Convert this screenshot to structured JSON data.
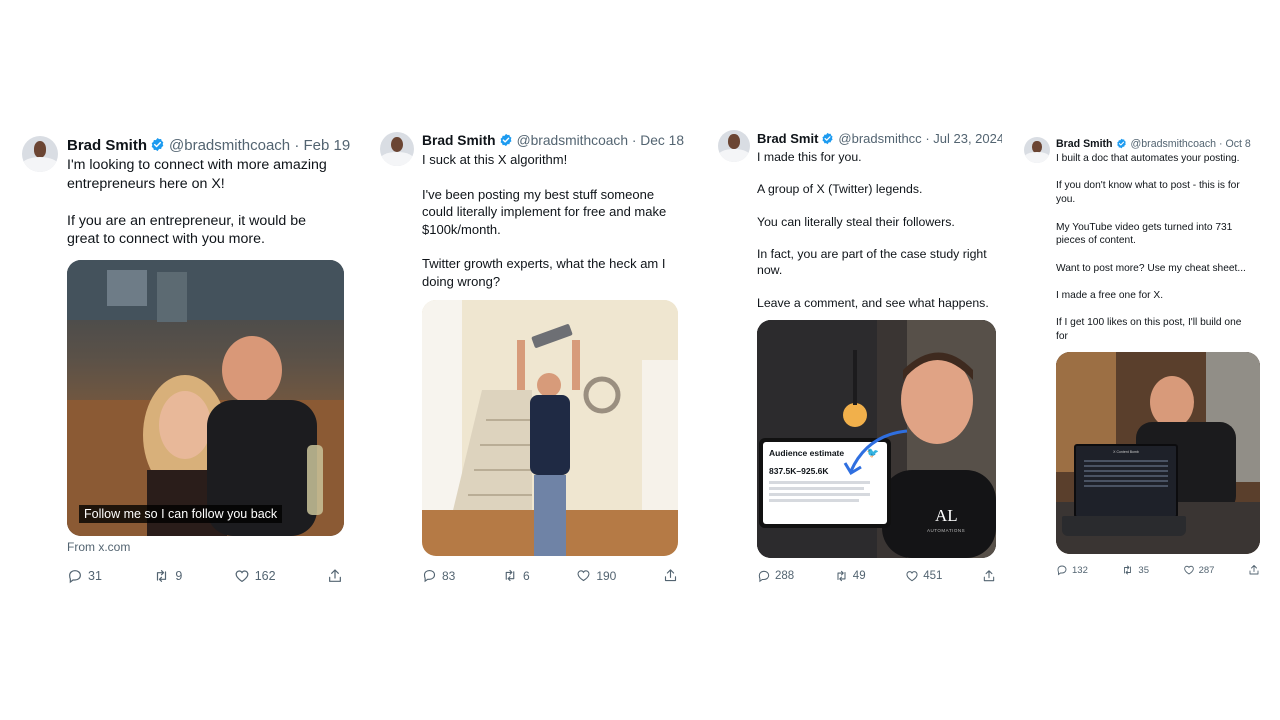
{
  "colors": {
    "verified": "#1d9bf0",
    "muted": "#536471",
    "text": "#0f1419"
  },
  "icons": {
    "verified": "verified-badge-icon",
    "reply": "reply-icon",
    "retweet": "retweet-icon",
    "like": "like-icon",
    "share": "share-icon"
  },
  "posts": [
    {
      "name": "Brad Smith",
      "handle": "@bradsmithcoach",
      "date": "· Feb 19",
      "lines": [
        "I'm looking to connect with more amazing",
        "entrepreneurs here on X!",
        "",
        "If you are an entrepreneur, it would be",
        "great to connect with you more."
      ],
      "media_caption": "Follow me so I can follow you back",
      "source": "From x.com",
      "stats": {
        "replies": "31",
        "reposts": "9",
        "likes": "162"
      }
    },
    {
      "name": "Brad Smith",
      "handle": "@bradsmithcoach",
      "date": "· Dec 18",
      "lines": [
        "I suck at this X algorithm!",
        "",
        "I've been posting my best stuff someone",
        "could literally implement for free and make",
        "$100k/month.",
        "",
        "Twitter growth experts, what the heck am I",
        "doing wrong?"
      ],
      "stats": {
        "replies": "83",
        "reposts": "6",
        "likes": "190"
      }
    },
    {
      "name": "Brad Smit",
      "handle": "@bradsmithcc",
      "date": "· Jul 23, 2024",
      "lines": [
        "I made this for you.",
        "",
        "A group of X (Twitter) legends.",
        "",
        "You can literally steal their followers.",
        "",
        "In fact, you are part of the case study right",
        "now.",
        "",
        "Leave a comment, and see what happens."
      ],
      "media": {
        "card_title": "Audience estimate",
        "card_value": "837.5K–925.6K",
        "shirt_text": "AL",
        "shirt_subtext": "AUTOMATIONS"
      },
      "stats": {
        "replies": "288",
        "reposts": "49",
        "likes": "451"
      }
    },
    {
      "name": "Brad Smith",
      "handle": "@bradsmithcoach",
      "date": "· Oct 8",
      "lines": [
        "I built a doc that automates your posting.",
        "",
        "If you don't know what to post - this is for",
        "you.",
        "",
        "My YouTube video gets turned into 731",
        "pieces of content.",
        "",
        "Want to post more? Use my cheat sheet...",
        "",
        "I made a free one for X.",
        "",
        "If I get 100 likes on this post, I'll build one",
        "for"
      ],
      "media": {
        "screen_title": "X Content Bomb"
      },
      "stats": {
        "replies": "132",
        "reposts": "35",
        "likes": "287"
      }
    }
  ]
}
